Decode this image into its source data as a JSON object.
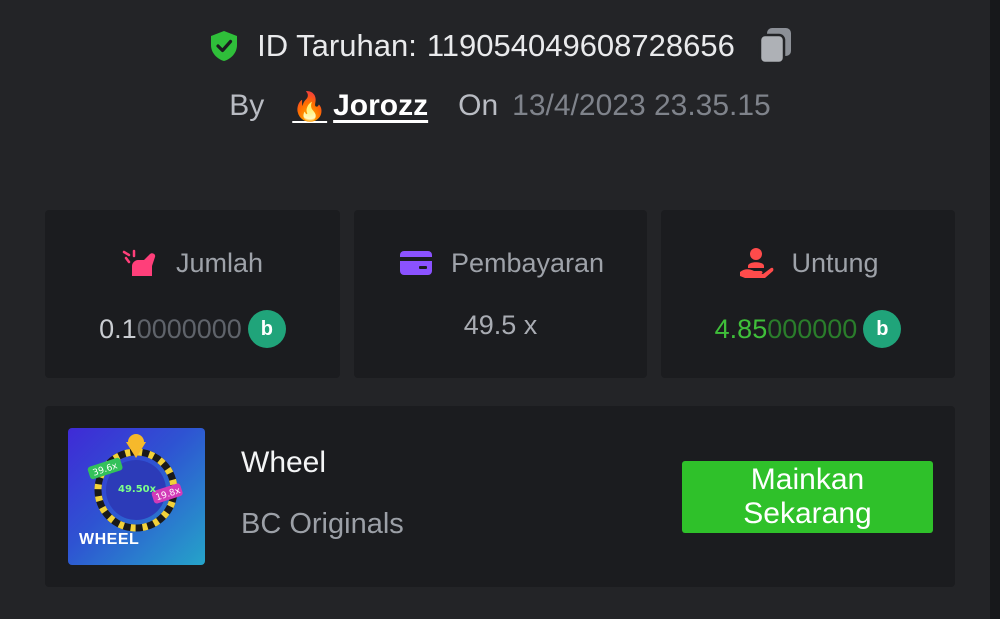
{
  "bet": {
    "id_label": "ID Taruhan:",
    "id_value": "119054049608728656",
    "by_label": "By",
    "username": "Jorozz",
    "on_label": "On",
    "datetime": "13/4/2023 23.35.15"
  },
  "stats": [
    {
      "label": "Jumlah",
      "value_main": "0.1",
      "value_rest": "0000000",
      "coin": "bc"
    },
    {
      "label": "Pembayaran",
      "value": "49.5 x"
    },
    {
      "label": "Untung",
      "value_main": "4.85",
      "value_rest": "000000",
      "coin": "bc"
    }
  ],
  "game": {
    "thumbnail_text": "WHEEL",
    "thumbnail_labels": [
      "39.6x",
      "49.50x",
      "19.8x"
    ],
    "title": "Wheel",
    "provider": "BC Originals",
    "play_label_line1": "Mainkan",
    "play_label_line2": "Sekarang"
  },
  "colors": {
    "background": "#232427",
    "card": "#1b1c1f",
    "accent_green": "#2fc12a",
    "profit_green": "#3fbf3a",
    "coin": "#20a47a"
  },
  "icons": {
    "verified": "shield-check-icon",
    "copy": "copy-icon",
    "amount": "bet-amount-icon",
    "payout": "wallet-card-icon",
    "profit": "hand-profit-icon",
    "coin": "bc-coin-icon",
    "user_badge": "fire-icon"
  }
}
